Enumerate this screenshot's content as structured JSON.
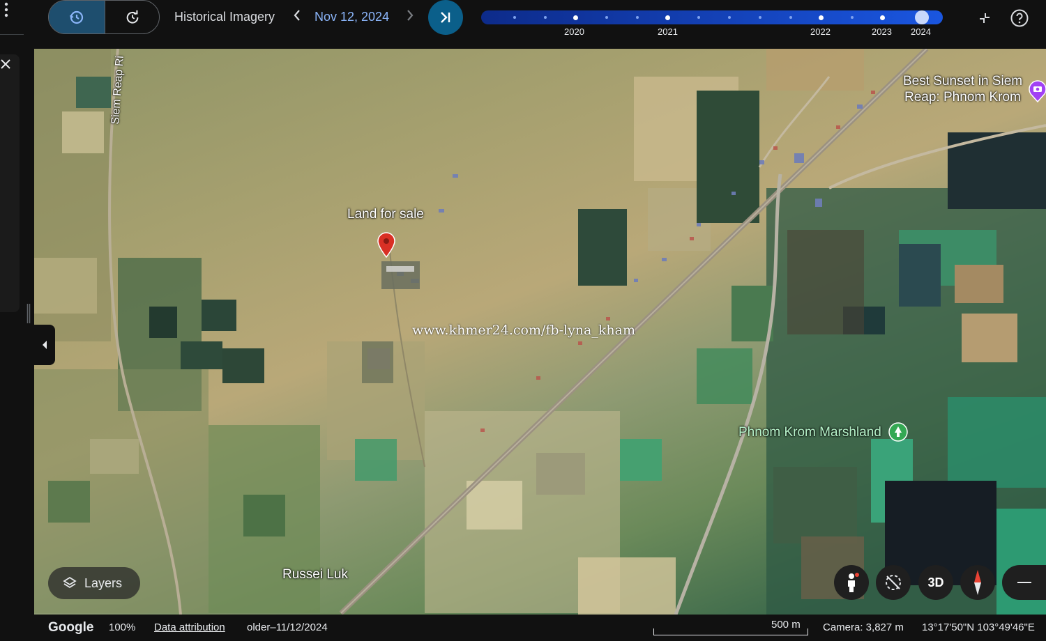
{
  "toolbar": {
    "historical_imagery_label": "Historical Imagery",
    "selected_date": "Nov 12, 2024",
    "timeline_years": [
      "2020",
      "2021",
      "2022",
      "2023",
      "2024"
    ]
  },
  "map": {
    "labels": {
      "road_siem_reap": "Siem Reap Ri",
      "land_for_sale": "Land for sale",
      "best_sunset_line1": "Best Sunset in Siem",
      "best_sunset_line2": "Reap: Phnom Krom",
      "phnom_krom_marshland": "Phnom Krom Marshland",
      "russei_luk": "Russei Luk"
    },
    "watermark": "www.khmer24.com/fb-lyna_kham",
    "layers_label": "Layers",
    "view_3d_label": "3D"
  },
  "footer": {
    "brand": "Google",
    "zoom": "100%",
    "data_attribution": "Data attribution",
    "imagery_date": "older–11/12/2024",
    "scale": "500 m",
    "camera": "Camera: 3,827 m",
    "coordinates": "13°17'50\"N 103°49'46\"E"
  },
  "colors": {
    "accent_blue": "#8ab4f8",
    "timeline_start": "#0d2b8a",
    "timeline_end": "#1a56e0",
    "pin_red": "#d93025",
    "park_green": "#34a853",
    "attraction_purple": "#a142f4"
  }
}
